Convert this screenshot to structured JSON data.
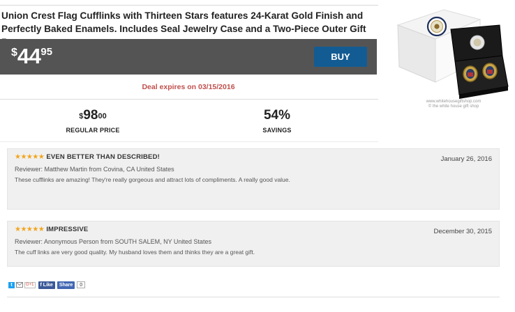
{
  "product": {
    "title": "Union Crest Flag Cufflinks with Thirteen Stars features 24-Karat Gold Finish and Perfectly Baked Enamels. Includes Seal Jewelry Case and a Two-Piece Outer Gift Box.",
    "image_caption": "www.whitehousegiftshop.com",
    "image_caption_small": "© the white house gift shop"
  },
  "price": {
    "currency": "$",
    "whole": "44",
    "cents": "95"
  },
  "buy_label": "BUY",
  "deal_expiry": "Deal expires on 03/15/2016",
  "regular_price": {
    "currency": "$",
    "whole": "98",
    "cents": "00",
    "label": "REGULAR PRICE"
  },
  "savings": {
    "value": "54%",
    "label": "SAVINGS"
  },
  "reviews": [
    {
      "rating": 5,
      "stars": "★★★★★",
      "title": "EVEN BETTER THAN DESCRIBED!",
      "date": "January 26, 2016",
      "reviewer": "Reviewer: Matthew Martin from Covina, CA United States",
      "text": "These cufflinks are amazing! They're really gorgeous and attract lots of compliments. A really good value."
    },
    {
      "rating": 5,
      "stars": "★★★★★",
      "title": "IMPRESSIVE",
      "date": "December 30, 2015",
      "reviewer": "Reviewer: Anonymous Person from SOUTH SALEM, NY United States",
      "text": "The cuff links are very good quality. My husband loves them and thinks they are a great gift."
    }
  ],
  "share": {
    "twitter_glyph": "t",
    "gplus_label": "G+1",
    "facebook_like": "Like",
    "facebook_share": "Share",
    "share_count": "0"
  },
  "colors": {
    "price_bar": "#545454",
    "buy_button": "#135c93",
    "deal_text": "#c0504d",
    "stars": "#f2a51c",
    "review_bg": "#f0f0f0"
  }
}
